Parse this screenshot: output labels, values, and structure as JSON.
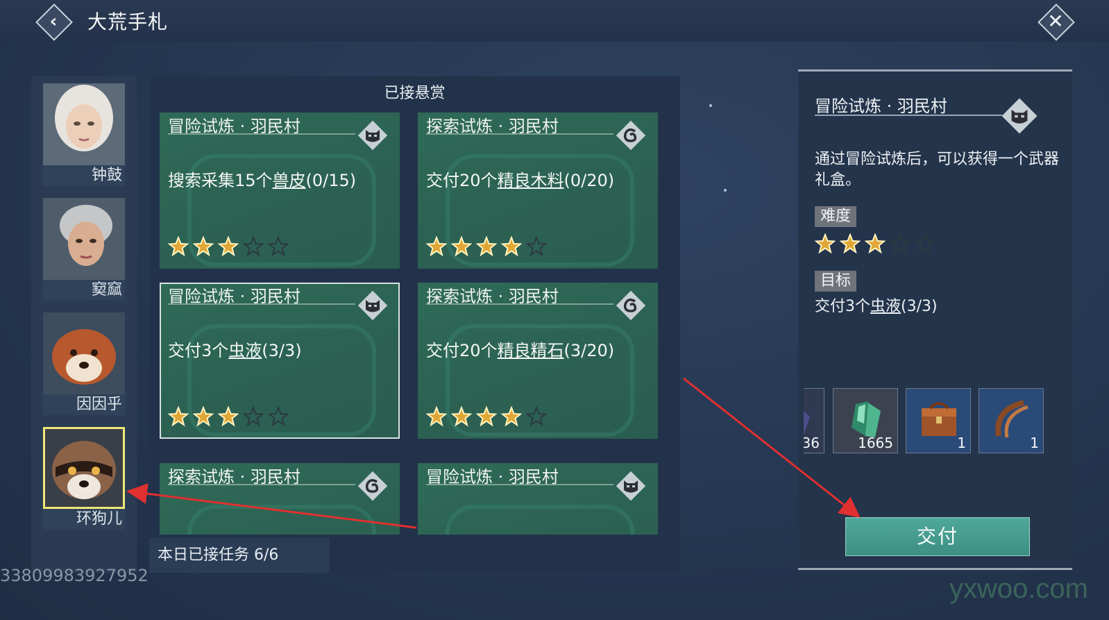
{
  "header": {
    "title": "大荒手札"
  },
  "characters": [
    {
      "name": "钟鼓"
    },
    {
      "name": "窫窳"
    },
    {
      "name": "因因乎"
    },
    {
      "name": "环狗儿"
    }
  ],
  "center": {
    "header": "已接悬赏",
    "cards": [
      {
        "title": "冒险试炼 · 羽民村",
        "icon": "mask-icon",
        "task_prefix": "搜索采集15个",
        "task_item": "兽皮",
        "task_progress": "(0/15)",
        "difficulty": 3
      },
      {
        "title": "探索试炼 · 羽民村",
        "icon": "swirl-icon",
        "task_prefix": "交付20个",
        "task_item": "精良木料",
        "task_progress": "(0/20)",
        "difficulty": 4
      },
      {
        "title": "冒险试炼 · 羽民村",
        "icon": "mask-icon",
        "task_prefix": "交付3个",
        "task_item": "虫液",
        "task_progress": "(3/3)",
        "difficulty": 3
      },
      {
        "title": "探索试炼 · 羽民村",
        "icon": "swirl-icon",
        "task_prefix": "交付20个",
        "task_item": "精良精石",
        "task_progress": "(3/20)",
        "difficulty": 4
      },
      {
        "title": "探索试炼 · 羽民村",
        "icon": "swirl-icon"
      },
      {
        "title": "冒险试炼 · 羽民村",
        "icon": "mask-icon"
      }
    ],
    "daily": "本日已接任务 6/6"
  },
  "player_id": "33809983927952",
  "detail": {
    "title": "冒险试炼 · 羽民村",
    "icon": "mask-icon",
    "description": "通过冒险试炼后，可以获得一个武器礼盒。",
    "difficulty_label": "难度",
    "difficulty": 3,
    "target_label": "目标",
    "target_prefix": "交付3个",
    "target_item": "虫液",
    "target_progress": "(3/3)",
    "rewards": [
      {
        "icon": "ore-icon",
        "count": "36"
      },
      {
        "icon": "jade-crystal-icon",
        "count": "1665"
      },
      {
        "icon": "treasure-chest-icon",
        "count": "1"
      },
      {
        "icon": "horn-bow-icon",
        "count": "1"
      }
    ],
    "submit_label": "交付"
  },
  "watermark": "yxwoo.com",
  "colors": {
    "card_green": "#2f6a57",
    "selected_outline": "#f2e778",
    "submit": "#4ea89a",
    "arrow": "#e03030"
  }
}
